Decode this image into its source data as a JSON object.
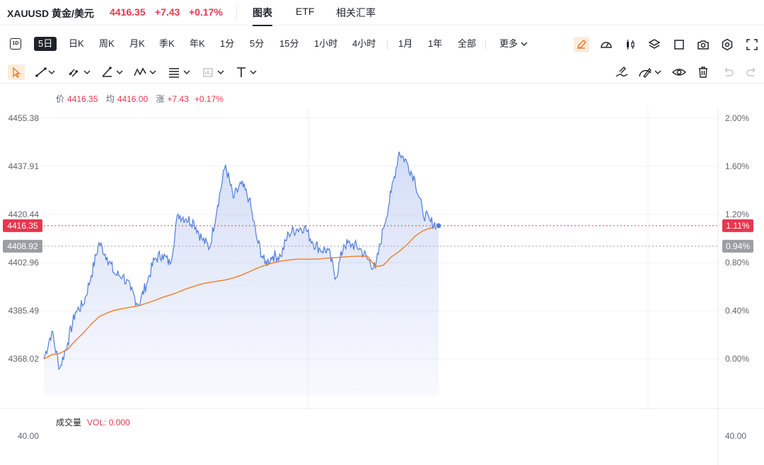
{
  "header": {
    "symbol": "XAUUSD 黄金/美元",
    "price": "4416.35",
    "change": "+7.43",
    "change_pct": "+0.17%",
    "tabs": [
      "图表",
      "ETF",
      "相关汇率"
    ],
    "active_tab": "图表"
  },
  "periods": {
    "first_icon": "1D",
    "items": [
      "5日",
      "日K",
      "周K",
      "月K",
      "季K",
      "年K",
      "1分",
      "5分",
      "15分",
      "1小时",
      "4小时",
      "1月",
      "1年",
      "全部",
      "更多"
    ],
    "active": "5日"
  },
  "toolbar_icons": [
    "pen-icon",
    "gauge-icon",
    "candles-icon",
    "layers-icon",
    "square-icon",
    "camera-icon",
    "gear-icon",
    "fullscreen-icon"
  ],
  "draw_tools": [
    "cursor-icon",
    "trendline-icon",
    "multi-point-icon",
    "angle-icon",
    "wave-icon",
    "fib-icon",
    "pattern-icon",
    "text-icon",
    "magnet-icon",
    "measure-icon",
    "eye-icon",
    "trash-icon",
    "undo-icon",
    "redo-icon"
  ],
  "legend": {
    "price_label": "价",
    "price_value": "4416.35",
    "avg_label": "均",
    "avg_value": "4416.00",
    "change_label": "涨",
    "change_value": "+7.43",
    "change_pct": "+0.17%"
  },
  "volume_legend": {
    "label": "成交量",
    "value": "VOL: 0.000"
  },
  "colors": {
    "price_line": "#4f7ddb",
    "avg_line": "#f07c2a",
    "up": "#e8364f",
    "tag_gray": "#9b9ea3"
  },
  "chart_data": {
    "type": "area",
    "y_ticks_left": [
      "4455.38",
      "4437.91",
      "4420.44",
      "4402.96",
      "4385.49",
      "4368.02"
    ],
    "y_ticks_right": [
      "2.00%",
      "1.60%",
      "1.20%",
      "0.80%",
      "0.40%",
      "0.00%"
    ],
    "ylim": [
      4368.02,
      4455.38
    ],
    "price_tag": "4416.35",
    "price_tag_pct": "1.11%",
    "ref_tag": "4408.92",
    "ref_tag_pct": "0.94%",
    "volume_ticks": [
      "40.00",
      "40.00"
    ],
    "x": [
      0,
      2,
      4,
      6,
      8,
      10,
      12,
      14,
      16,
      18,
      20,
      22,
      24,
      26,
      28,
      30,
      32,
      34,
      36,
      38,
      40,
      42,
      44,
      46,
      48,
      50,
      52,
      54,
      56,
      58,
      60,
      62,
      64,
      66,
      68,
      70,
      72,
      74,
      76,
      78,
      80,
      82,
      84,
      86,
      88,
      90,
      92,
      94,
      96,
      98,
      100
    ],
    "series": [
      {
        "values": [
          4368.0,
          4378.0,
          4364.5,
          4373.8,
          4385.0,
          4387.8,
          4398.2,
          4410.2,
          4405.0,
          4398.7,
          4398.2,
          4393.1,
          4387.6,
          4395.3,
          4404.0,
          4406.0,
          4402.4,
          4420.6,
          4418.9,
          4417.8,
          4411.6,
          4408.4,
          4423.7,
          4438.5,
          4426.4,
          4431.5,
          4426.1,
          4411.4,
          4402.5,
          4405.4,
          4405.3,
          4413.6,
          4415.1,
          4416.0,
          4410.6,
          4407.8,
          4407.5,
          4397.5,
          4409.5,
          4409.6,
          4408.2,
          4404.2,
          4400.8,
          4415.3,
          4428.4,
          4443.2,
          4439.2,
          4433.2,
          4421.0,
          4417.8,
          4416.35
        ]
      },
      {
        "values": [
          4368.0,
          4369.5,
          4370.0,
          4371.5,
          4374.6,
          4377.4,
          4380.6,
          4383.3,
          4384.7,
          4385.7,
          4386.3,
          4386.8,
          4387.3,
          4388.2,
          4389.2,
          4390.3,
          4391.2,
          4392.2,
          4393.4,
          4394.3,
          4395.2,
          4395.8,
          4396.2,
          4396.7,
          4397.4,
          4398.4,
          4399.6,
          4400.9,
          4402.0,
          4402.8,
          4403.5,
          4403.9,
          4404.2,
          4404.2,
          4404.2,
          4404.3,
          4404.6,
          4404.8,
          4405.0,
          4405.2,
          4405.3,
          4405.3,
          4401.5,
          4402.0,
          4405.0,
          4407.0,
          4409.5,
          4412.5,
          4414.5,
          4415.5,
          4416.0
        ]
      }
    ],
    "grid": true
  }
}
